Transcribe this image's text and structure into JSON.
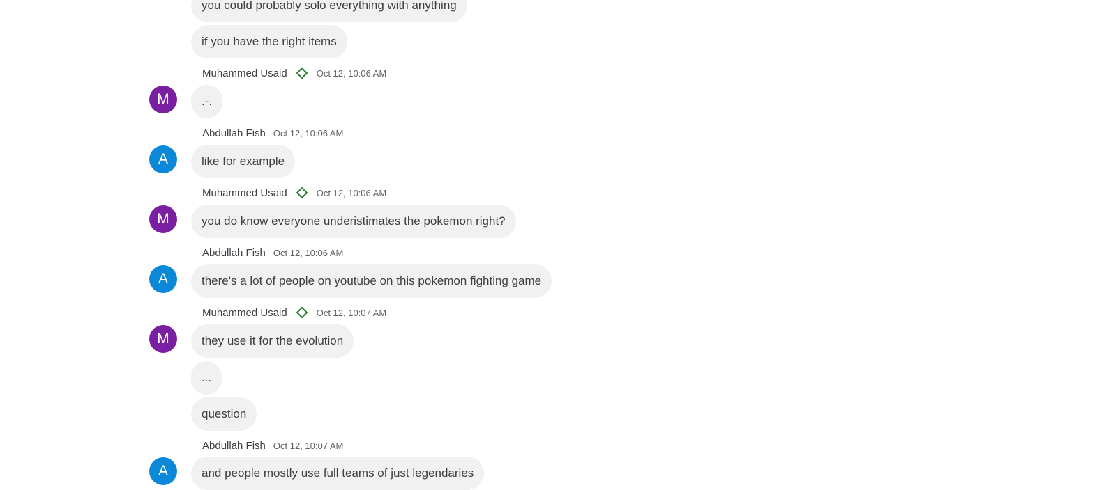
{
  "colors": {
    "avatar_m": "#7b1fa2",
    "avatar_a": "#0b88d8",
    "bubble_bg": "#f1f1f1",
    "moderator_icon": "#2e7d32"
  },
  "messages": [
    {
      "text": "you could probably solo everything with anything"
    },
    {
      "text": "if you have the right items"
    },
    {
      "sender": "Muhammed Usaid",
      "role_icon": "diamond-moderator-icon",
      "time": "Oct 12, 10:06 AM",
      "avatar_letter": "M",
      "text": ".-."
    },
    {
      "sender": "Abdullah Fish",
      "time": "Oct 12, 10:06 AM",
      "avatar_letter": "A",
      "text": "like for example"
    },
    {
      "sender": "Muhammed Usaid",
      "role_icon": "diamond-moderator-icon",
      "time": "Oct 12, 10:06 AM",
      "avatar_letter": "M",
      "text": "you do know everyone underistimates the pokemon right?"
    },
    {
      "sender": "Abdullah Fish",
      "time": "Oct 12, 10:06 AM",
      "avatar_letter": "A",
      "text": "there's a lot of people on youtube on this pokemon fighting game"
    },
    {
      "sender": "Muhammed Usaid",
      "role_icon": "diamond-moderator-icon",
      "time": "Oct 12, 10:07 AM",
      "avatar_letter": "M",
      "text": "they use it for the evolution"
    },
    {
      "text": "..."
    },
    {
      "text": "question"
    },
    {
      "sender": "Abdullah Fish",
      "time": "Oct 12, 10:07 AM",
      "avatar_letter": "A",
      "text": "and people mostly use full teams of just legendaries"
    }
  ]
}
